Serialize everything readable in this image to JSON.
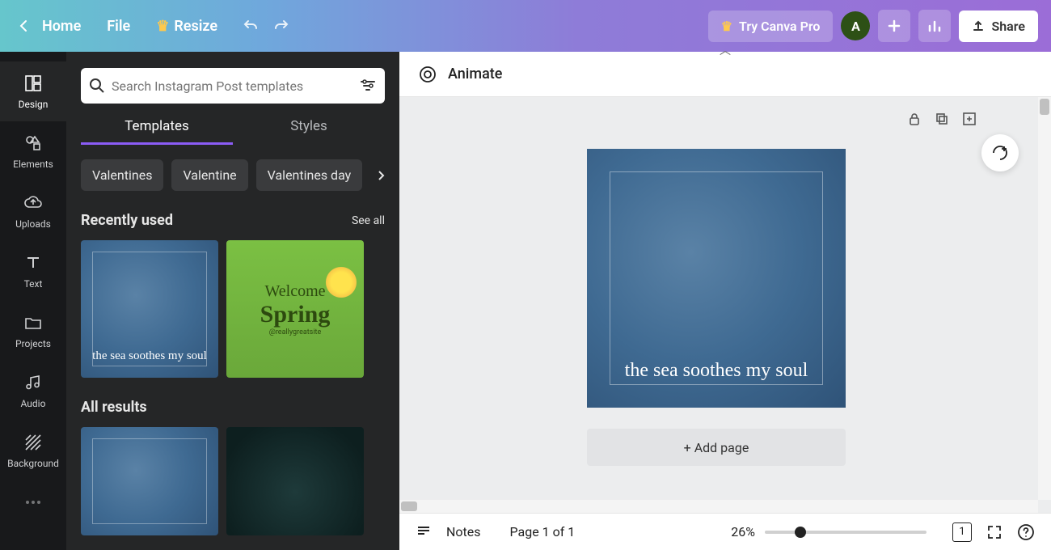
{
  "topbar": {
    "home": "Home",
    "file": "File",
    "resize": "Resize",
    "try_pro": "Try Canva Pro",
    "avatar_initial": "A",
    "share": "Share"
  },
  "rail": {
    "items": [
      {
        "label": "Design"
      },
      {
        "label": "Elements"
      },
      {
        "label": "Uploads"
      },
      {
        "label": "Text"
      },
      {
        "label": "Projects"
      },
      {
        "label": "Audio"
      },
      {
        "label": "Background"
      }
    ]
  },
  "panel": {
    "search_placeholder": "Search Instagram Post templates",
    "tabs": {
      "templates": "Templates",
      "styles": "Styles"
    },
    "chips": [
      "Valentines",
      "Valentine",
      "Valentines day"
    ],
    "recent": {
      "title": "Recently used",
      "seeall": "See all"
    },
    "thumb_blue_caption": "the sea soothes my soul",
    "thumb_green": {
      "l1": "Welcome",
      "l2": "Spring",
      "l3": "@reallygreatsite"
    },
    "all_results": "All results"
  },
  "toolbar": {
    "animate": "Animate"
  },
  "canvas": {
    "text": "the sea soothes my soul",
    "add_page": "+ Add page"
  },
  "footer": {
    "notes": "Notes",
    "page": "Page 1 of 1",
    "zoom_pct": "26%",
    "page_num": "1"
  }
}
